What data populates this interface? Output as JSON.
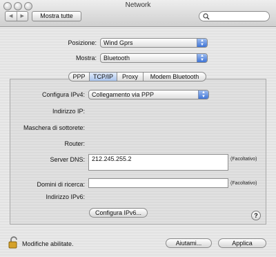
{
  "window": {
    "title": "Network"
  },
  "toolbar": {
    "show_all_label": "Mostra tutte",
    "back_glyph": "◀",
    "forward_glyph": "▶",
    "search_placeholder": ""
  },
  "location": {
    "label": "Posizione:",
    "value": "Wind Gprs"
  },
  "show": {
    "label": "Mostra:",
    "value": "Bluetooth"
  },
  "tabs": [
    {
      "label": "PPP",
      "selected": false
    },
    {
      "label": "TCP/IP",
      "selected": true
    },
    {
      "label": "Proxy",
      "selected": false
    },
    {
      "label": "Modem Bluetooth",
      "selected": false
    }
  ],
  "ipv4": {
    "label": "Configura IPv4:",
    "value": "Collegamento via PPP"
  },
  "ip_address": {
    "label": "Indirizzo IP:"
  },
  "subnet": {
    "label": "Maschera di sottorete:"
  },
  "router": {
    "label": "Router:"
  },
  "dns": {
    "label": "Server DNS:",
    "value": "212.245.255.2",
    "hint": "(Facoltativo)"
  },
  "search_domains": {
    "label": "Domini di ricerca:",
    "value": "",
    "hint": "(Facoltativo)"
  },
  "ipv6": {
    "label": "Indirizzo IPv6:",
    "button_label": "Configura IPv6..."
  },
  "help": {
    "glyph": "?"
  },
  "footer": {
    "lock_text": "Modifiche abilitate.",
    "assist_label": "Aiutami...",
    "apply_label": "Applica"
  }
}
